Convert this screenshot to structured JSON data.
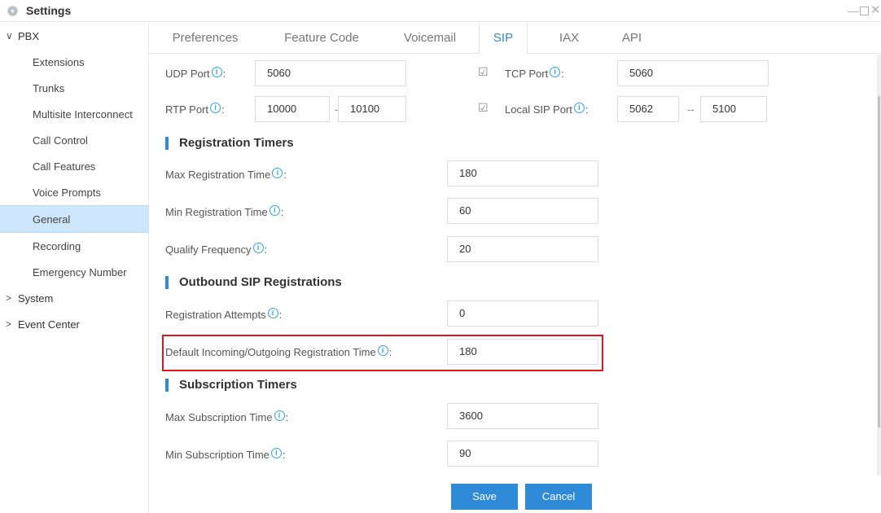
{
  "window": {
    "title": "Settings",
    "controls": {
      "minimize": "—",
      "close": "✕"
    }
  },
  "sidebar": {
    "pbx": {
      "label": "PBX",
      "expanded": true,
      "items": [
        {
          "label": "Extensions",
          "active": false
        },
        {
          "label": "Trunks",
          "active": false
        },
        {
          "label": "Multisite Interconnect",
          "active": false
        },
        {
          "label": "Call Control",
          "active": false
        },
        {
          "label": "Call Features",
          "active": false
        },
        {
          "label": "Voice Prompts",
          "active": false
        },
        {
          "label": "General",
          "active": true
        },
        {
          "label": "Recording",
          "active": false
        },
        {
          "label": "Emergency Number",
          "active": false
        }
      ]
    },
    "system": {
      "label": "System",
      "expanded": false
    },
    "event_center": {
      "label": "Event Center",
      "expanded": false
    },
    "icons": {
      "expanded": "⌄",
      "collapsed": "›"
    }
  },
  "tabs": [
    {
      "label": "Preferences",
      "active": false
    },
    {
      "label": "Feature Code",
      "active": false
    },
    {
      "label": "Voicemail",
      "active": false
    },
    {
      "label": "SIP",
      "active": true
    },
    {
      "label": "IAX",
      "active": false
    },
    {
      "label": "API",
      "active": false
    }
  ],
  "ports": {
    "udp": {
      "label": "UDP Port",
      "value": "5060"
    },
    "rtp": {
      "label": "RTP Port",
      "from": "10000",
      "to": "10100"
    },
    "tcp": {
      "label": "TCP Port",
      "value": "5060",
      "checked": true
    },
    "local_sip": {
      "label": "Local SIP Port",
      "from": "5062",
      "to": "5100",
      "checked": true
    },
    "range_separator": "--"
  },
  "sections": {
    "registration_timers": {
      "title": "Registration Timers",
      "fields": [
        {
          "label": "Max Registration Time",
          "value": "180"
        },
        {
          "label": "Min Registration Time",
          "value": "60"
        },
        {
          "label": "Qualify Frequency",
          "value": "20"
        }
      ]
    },
    "outbound_sip": {
      "title": "Outbound SIP Registrations",
      "fields": [
        {
          "label": "Registration Attempts",
          "value": "0"
        },
        {
          "label": "Default Incoming/Outgoing Registration Time",
          "value": "180",
          "highlighted": true
        }
      ]
    },
    "subscription_timers": {
      "title": "Subscription Timers",
      "fields": [
        {
          "label": "Max Subscription Time",
          "value": "3600"
        },
        {
          "label": "Min Subscription Time",
          "value": "90"
        }
      ]
    }
  },
  "glyphs": {
    "info": "i",
    "colon": ":",
    "check": "☑"
  },
  "actions": {
    "save": "Save",
    "cancel": "Cancel"
  },
  "colors": {
    "accent": "#2f8ad8",
    "info": "#2ea5e0",
    "highlight": "#e0161c",
    "active_nav": "#cde6fb"
  }
}
